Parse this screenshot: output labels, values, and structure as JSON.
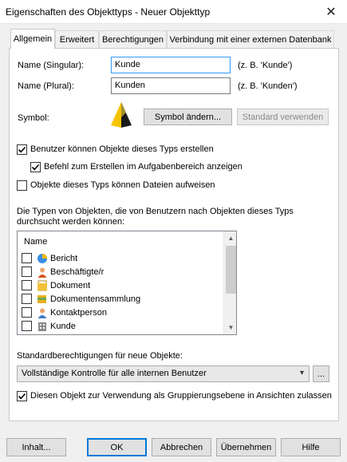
{
  "window": {
    "title": "Eigenschaften des Objekttyps - Neuer Objekttyp",
    "close_glyph": "✕"
  },
  "tabs": [
    {
      "label": "Allgemein",
      "active": true
    },
    {
      "label": "Erweitert"
    },
    {
      "label": "Berechtigungen"
    },
    {
      "label": "Verbindung mit einer externen Datenbank"
    }
  ],
  "general": {
    "name_singular": {
      "label": "Name (Singular):",
      "value": "Kunde",
      "hint": "(z. B. 'Kunde')"
    },
    "name_plural": {
      "label": "Name (Plural):",
      "value": "Kunden",
      "hint": "(z. B. 'Kunden')"
    },
    "symbol": {
      "label": "Symbol:",
      "change_button": "Symbol ändern...",
      "default_button": "Standard verwenden"
    },
    "checkboxes": {
      "users_can_create": {
        "label": "Benutzer können Objekte dieses Typs erstellen",
        "checked": true
      },
      "create_command": {
        "label": "Befehl zum Erstellen im Aufgabenbereich anzeigen",
        "checked": true
      },
      "can_contain_files": {
        "label": "Objekte dieses Typs können Dateien aufweisen",
        "checked": false
      }
    },
    "search_types": {
      "description": "Die Typen von Objekten, die von Benutzern nach Objekten dieses Typs durchsucht werden können:",
      "column_header": "Name",
      "items": [
        {
          "label": "Bericht",
          "icon": "report-icon",
          "checked": false
        },
        {
          "label": "Beschäftigte/r",
          "icon": "employee-icon",
          "checked": false
        },
        {
          "label": "Dokument",
          "icon": "document-icon",
          "checked": false
        },
        {
          "label": "Dokumentensammlung",
          "icon": "document-collection-icon",
          "checked": false
        },
        {
          "label": "Kontaktperson",
          "icon": "contact-person-icon",
          "checked": false
        },
        {
          "label": "Kunde",
          "icon": "customer-icon",
          "checked": false
        }
      ]
    },
    "default_permissions": {
      "label": "Standardberechtigungen für neue Objekte:",
      "selected": "Vollständige Kontrolle für alle internen Benutzer",
      "more_button": "..."
    },
    "grouping_level": {
      "label": "Diesen Objekt zur Verwendung als Gruppierungsebene in Ansichten zulassen",
      "checked": true
    }
  },
  "footer": {
    "contents": "Inhalt...",
    "ok": "OK",
    "cancel": "Abbrechen",
    "apply": "Übernehmen",
    "help": "Hilfe"
  },
  "colors": {
    "accent": "#0078d7",
    "focus_border": "#3399ff",
    "symbol_yellow": "#f5c400"
  }
}
